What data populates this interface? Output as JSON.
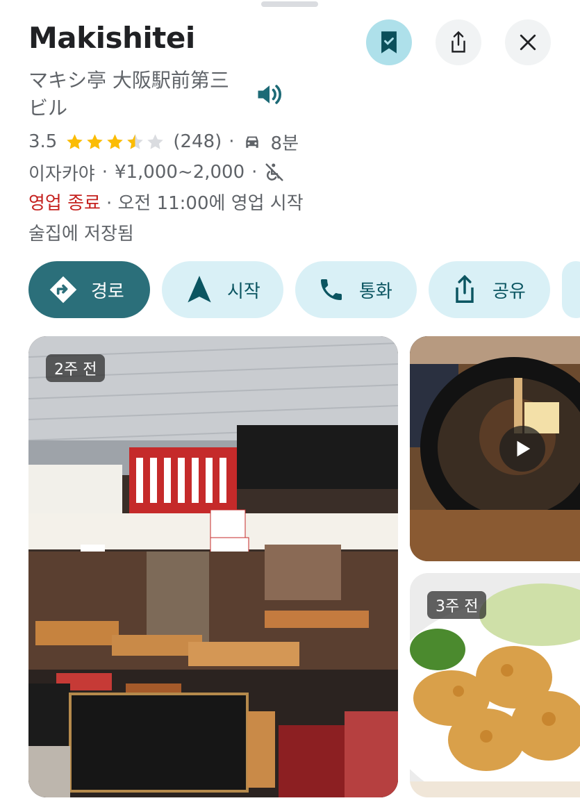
{
  "place": {
    "name": "Makishitei",
    "native_name": "マキシ亭 大阪駅前第三ビル",
    "rating": "3.5",
    "review_count": "(248)",
    "drive_time": "8분",
    "category": "이자카야",
    "price_range": "¥1,000~2,000",
    "status": "영업 종료",
    "hours_note": "· 오전 11:00에 영업 시작",
    "saved_list": "술집에 저장됨",
    "separator": "·"
  },
  "actions": [
    {
      "label": "경로",
      "icon": "directions-icon"
    },
    {
      "label": "시작",
      "icon": "navigation-arrow-icon"
    },
    {
      "label": "통화",
      "icon": "phone-icon"
    },
    {
      "label": "공유",
      "icon": "share-icon"
    }
  ],
  "photos": {
    "main_badge": "2주 전",
    "chicken_badge": "3주 전"
  },
  "colors": {
    "primary_chip": "#2b6f7a",
    "chip": "#d9f0f6",
    "closed_text": "#c5221f",
    "star": "#fbbc04"
  }
}
